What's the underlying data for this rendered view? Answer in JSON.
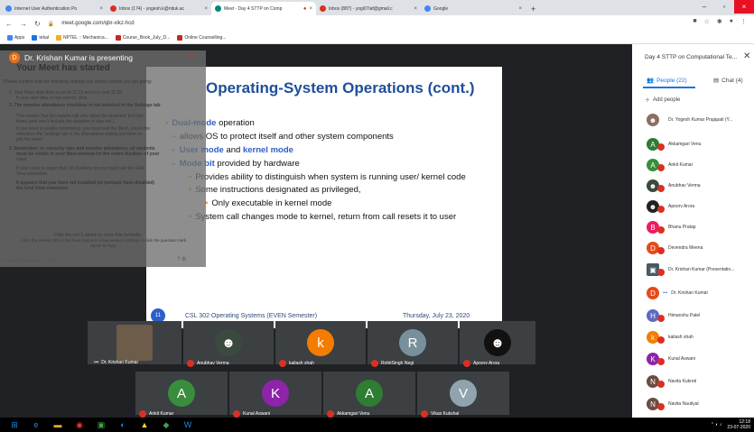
{
  "browser": {
    "tabs": [
      {
        "label": "Internet User Authentication Po",
        "color": "#4285f4"
      },
      {
        "label": "Inbox (174) - yogesh.k@nituk.ac",
        "color": "#d93025"
      },
      {
        "label": "Meet - Day 4 STTP on Comp",
        "color": "#00897b"
      },
      {
        "label": "Inbox (887) - yogi07iaf@gmail.c",
        "color": "#d93025"
      },
      {
        "label": "Google",
        "color": "#4285f4"
      }
    ],
    "url": "meet.google.com/qbr-xikz-hcd",
    "bookmarks": [
      "Apps",
      "tekal",
      "NPTEL :: Mechanica...",
      "Course_Book_July_D...",
      "Online Counselling..."
    ]
  },
  "presenting": {
    "initial": "D",
    "text": "Dr. Krishan Kumar is presenting"
  },
  "popup": {
    "title": "Your Meet has started",
    "lines": [
      "Please confirm that the following settings are correct before you get going:",
      "1. Your Meet start time is set to 11:23 and it is now 11:23.",
      "If your start time is not correct, click",
      "2. The monitor attendance checkbox is not selected in the Settings tab",
      "This means that the reports will only show the students' first join",
      "times (and won't include the duration of stay etc.).",
      "If you want to enable monitoring, you must exit the Meet, check the",
      "checkbox the Settings tab in the Attendance dialog and then re-",
      "join the meet",
      "3. Remember: to correctly take and monitor attendance, all students",
      "must be visible in your Meet window for the entire duration of your",
      "class",
      "If your class is larger than 16 students so you must use the Grid",
      "View extension.",
      "It appears that you have not installed (or perhaps have disabled)",
      "the Grid View extension.",
      "Click the red X above to close this reminder.",
      "Click the session title in the footer below to show session settings or click the question mark",
      "above for help."
    ],
    "version": "Google Meet Attendance - v4.2.13"
  },
  "slide": {
    "title": "Operating-System Operations (cont.)",
    "bullets": [
      {
        "kind": "top",
        "bold": "Dual-mode",
        "text": " operation"
      },
      {
        "kind": "arrow",
        "text": "allows OS to protect itself and other system components"
      },
      {
        "kind": "arrow",
        "bold1": "User mode",
        "mid": " and ",
        "bold2": "kernel mode"
      },
      {
        "kind": "arrow",
        "bold": "Mode bit",
        "text": " provided by hardware"
      },
      {
        "kind": "sub",
        "text": "Provides ability to distinguish when system is running user/ kernel code"
      },
      {
        "kind": "sub",
        "text": "Some instructions designated as privileged,"
      },
      {
        "kind": "subsub",
        "text": "Only executable in kernel mode"
      },
      {
        "kind": "sub",
        "text": "System call changes mode to kernel, return from call resets it to user"
      }
    ],
    "number": "11",
    "footer_left": "CSL 302 Operating Systems (EVEN Semester)",
    "footer_right": "Thursday, July 23, 2020"
  },
  "tiles": [
    {
      "name": "Dr. Krishan Kumar",
      "initial": "",
      "color": "#5a5a5a"
    },
    {
      "name": "Anubhav Verma",
      "initial": "",
      "color": "#3b4a3f"
    },
    {
      "name": "kailash shah",
      "initial": "k",
      "color": "#f57c00"
    },
    {
      "name": "RohitSingh Negi",
      "initial": "R",
      "color": "#78909c"
    },
    {
      "name": "Apoorv Arora",
      "initial": "",
      "color": "#222222"
    },
    {
      "name": "Ankit Kumar",
      "initial": "A",
      "color": "#388e3c"
    },
    {
      "name": "Kunal Aswani",
      "initial": "K",
      "color": "#8e24aa"
    },
    {
      "name": "Akkamgari Venu",
      "initial": "A",
      "color": "#2e7d32"
    },
    {
      "name": "Vikas Kukshal",
      "initial": "V",
      "color": "#90a4ae"
    }
  ],
  "panel": {
    "title": "Day 4 STTP on Computational Te...",
    "people_tab": "People (22)",
    "chat_tab": "Chat (4)",
    "add_people": "Add people",
    "participants": [
      {
        "name": "Dr. Yogesh Kumar Prajapati (Y...",
        "initial": "",
        "color": "#8d6e63"
      },
      {
        "name": "Akkamgari Venu",
        "initial": "A",
        "color": "#2e7d32"
      },
      {
        "name": "Ankit Kumar",
        "initial": "A",
        "color": "#388e3c"
      },
      {
        "name": "Anubhav Verma",
        "initial": "",
        "color": "#3b4a3f"
      },
      {
        "name": "Apoorv Arora",
        "initial": "",
        "color": "#222222"
      },
      {
        "name": "Bhanu Pratap",
        "initial": "B",
        "color": "#e91e63"
      },
      {
        "name": "Devendra Meena",
        "initial": "D",
        "color": "#e64a19"
      },
      {
        "name": "Dr. Krishan Kumar (Presentatio...",
        "initial": "▣",
        "color": "#455a64"
      },
      {
        "name": "Dr. Krishan Kumar",
        "initial": "D",
        "color": "#e64a19"
      },
      {
        "name": "Himanshu Patel",
        "initial": "H",
        "color": "#5c6bc0"
      },
      {
        "name": "kailash shah",
        "initial": "k",
        "color": "#f57c00"
      },
      {
        "name": "Kunal Aswani",
        "initial": "K",
        "color": "#8e24aa"
      },
      {
        "name": "Navita Kukreti",
        "initial": "N",
        "color": "#6d4c41"
      },
      {
        "name": "Navita Nautiyal",
        "initial": "N",
        "color": "#6d4c41"
      }
    ]
  },
  "tray": {
    "time": "12:18",
    "date": "23-07-2020"
  }
}
